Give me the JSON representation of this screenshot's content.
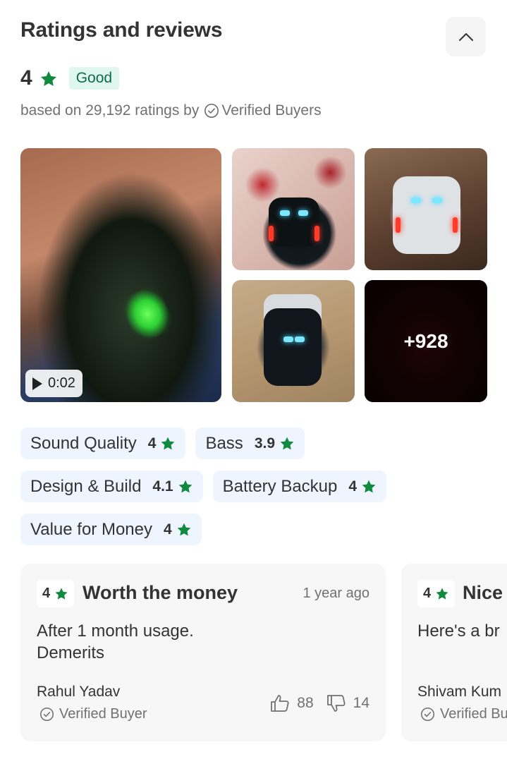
{
  "header": {
    "title": "Ratings and reviews",
    "collapse_icon": "chevron-up-icon"
  },
  "summary": {
    "average": "4",
    "badge": "Good",
    "based_prefix": "based on 29,192 ratings by",
    "verified_label": "Verified Buyers"
  },
  "colors": {
    "star": "#0f8a3f",
    "badge_bg": "#e0f7ef",
    "chip_bg": "#eef5ff",
    "card_bg": "#f7f7f7"
  },
  "gallery": {
    "video_duration": "0:02",
    "more_count": "+928",
    "play_icon": "play-icon"
  },
  "aspects": [
    {
      "label": "Sound Quality",
      "score": "4"
    },
    {
      "label": "Bass",
      "score": "3.9"
    },
    {
      "label": "Design & Build",
      "score": "4.1"
    },
    {
      "label": "Battery Backup",
      "score": "4"
    },
    {
      "label": "Value for Money",
      "score": "4"
    }
  ],
  "reviews": [
    {
      "rating": "4",
      "title": "Worth the money",
      "time": "1 year ago",
      "body_line1": "After 1 month usage.",
      "body_line2": "Demerits",
      "author": "Rahul Yadav",
      "verified": "Verified Buyer",
      "likes": "88",
      "dislikes": "14"
    },
    {
      "rating": "4",
      "title": "Nice",
      "body_line1": "Here's a br",
      "author": "Shivam Kum",
      "verified": "Verified Bu"
    }
  ]
}
